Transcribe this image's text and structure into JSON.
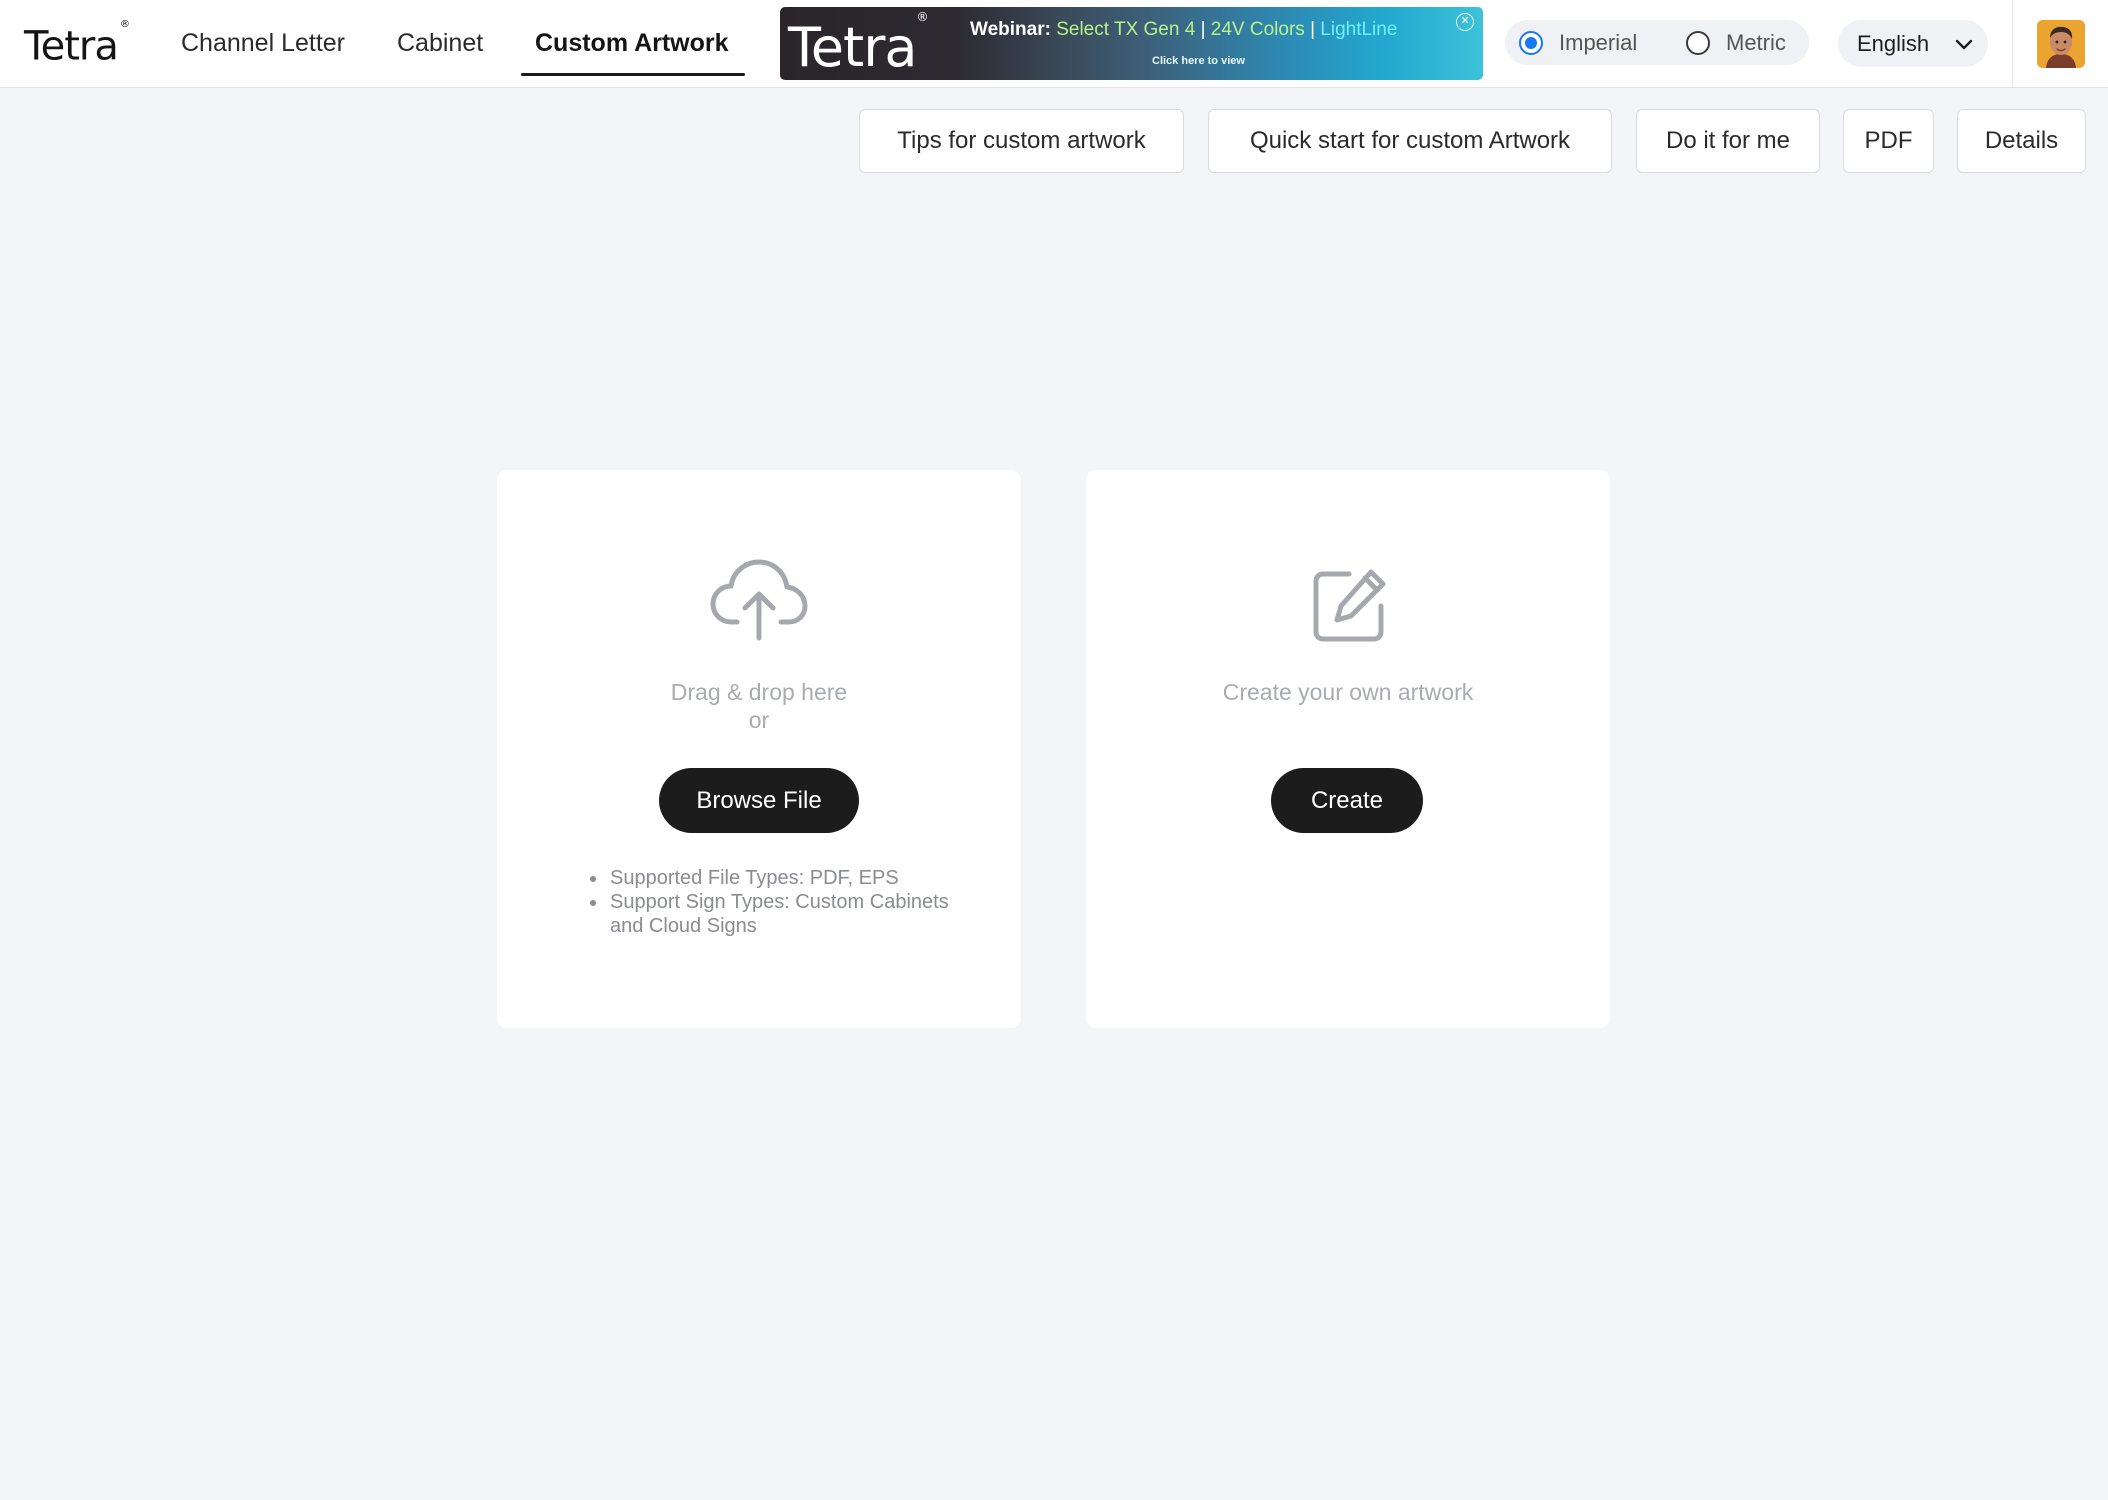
{
  "app": {
    "brand": "Tetra",
    "brand_mark": "®"
  },
  "nav": {
    "tabs": [
      {
        "label": "Channel Letter",
        "active": false
      },
      {
        "label": "Cabinet",
        "active": false
      },
      {
        "label": "Custom Artwork",
        "active": true
      }
    ]
  },
  "banner": {
    "brand": "Tetra",
    "brand_mark": "®",
    "lead": "Webinar:",
    "item1": "Select TX Gen 4",
    "separator": "|",
    "item2": "24V Colors",
    "item3": "LightLine",
    "cta": "Click here to view",
    "close_glyph": "✕"
  },
  "units": {
    "options": [
      {
        "label": "Imperial",
        "selected": true
      },
      {
        "label": "Metric",
        "selected": false
      }
    ]
  },
  "language": {
    "selected": "English"
  },
  "toolbar": {
    "buttons": [
      {
        "label": "Tips for custom artwork"
      },
      {
        "label": "Quick start for custom Artwork"
      },
      {
        "label": "Do it for me"
      },
      {
        "label": "PDF"
      },
      {
        "label": "Details"
      }
    ]
  },
  "upload_card": {
    "drag_text": "Drag & drop here",
    "or_text": "or",
    "button_label": "Browse File",
    "notes": [
      "Supported File Types: PDF, EPS",
      "Support Sign Types: Custom Cabinets and Cloud Signs"
    ]
  },
  "create_card": {
    "text": "Create your own artwork",
    "button_label": "Create"
  },
  "colors": {
    "accent": "#1877f2",
    "primary_button": "#1c1c1c",
    "page_background": "#f4f5f7"
  },
  "icons": {
    "upload": "cloud-upload-icon",
    "create": "edit-square-icon",
    "language": "chevron-down-icon",
    "banner_close": "close-icon"
  }
}
